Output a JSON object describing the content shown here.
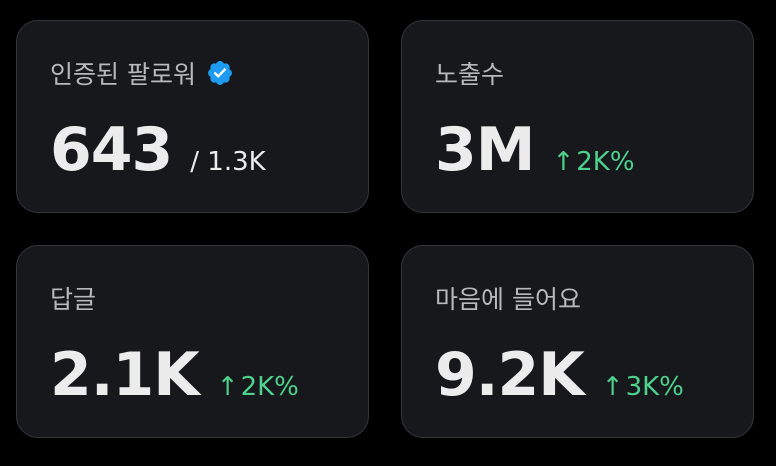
{
  "cards": [
    {
      "label": "인증된 팔로워",
      "value": "643",
      "sub": "/ 1.3K",
      "icon": "verified-badge-icon"
    },
    {
      "label": "노출수",
      "value": "3M",
      "change": "2K%",
      "change_icon": "arrow-up-icon"
    },
    {
      "label": "답글",
      "value": "2.1K",
      "change": "2K%",
      "change_icon": "arrow-up-icon"
    },
    {
      "label": "마음에 들어요",
      "value": "9.2K",
      "change": "3K%",
      "change_icon": "arrow-up-icon"
    }
  ],
  "colors": {
    "page_background": "#000000",
    "card_background": "#17181c",
    "card_border": "#34363c",
    "label": "#b7b9be",
    "value": "#ececec",
    "positive_change": "#4ed18c",
    "verified_badge": "#1d9bf0"
  }
}
